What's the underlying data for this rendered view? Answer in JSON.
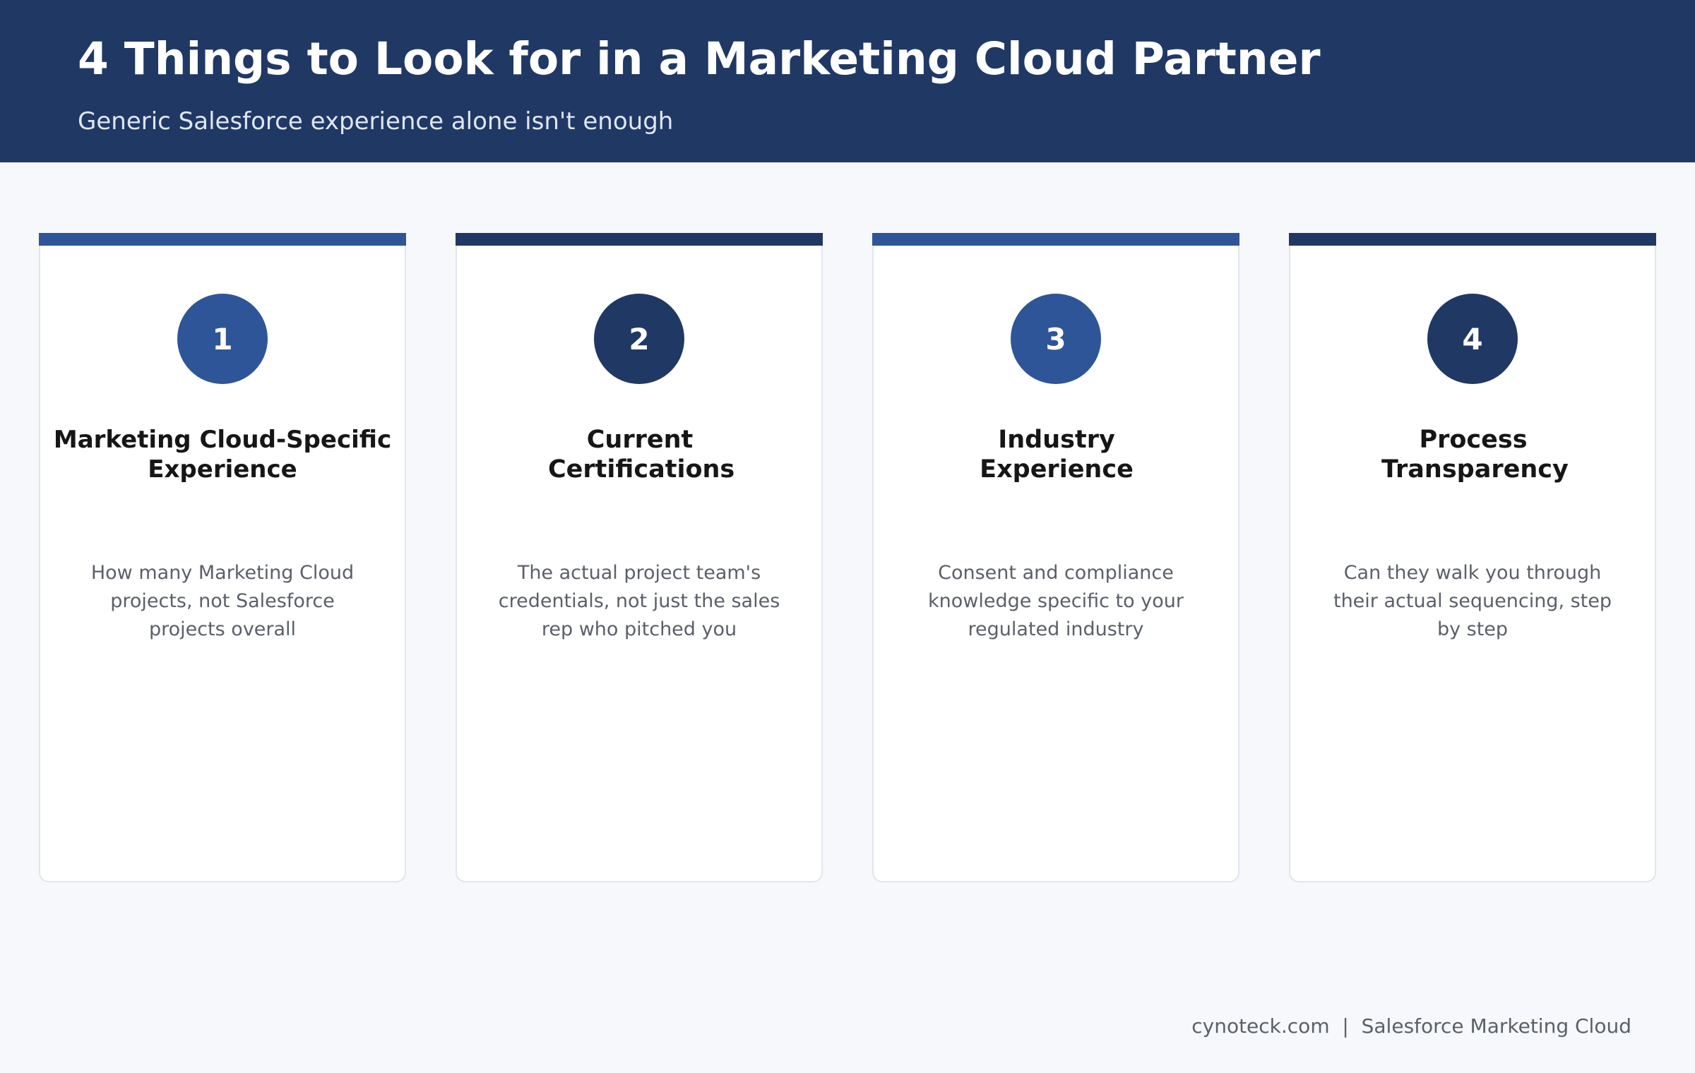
{
  "header": {
    "title": "4 Things to Look for in a Marketing Cloud Partner",
    "subtitle": "Generic Salesforce experience alone isn't enough"
  },
  "colors": {
    "header_bg": "#203864",
    "accent_light": "#2e5597",
    "accent_dark": "#203864",
    "page_bg": "#f7f8fb"
  },
  "cards": [
    {
      "number": "1",
      "title": "Marketing Cloud-Specific Experience",
      "description": "How many Marketing Cloud projects, not Salesforce projects overall",
      "color": "#2e5597"
    },
    {
      "number": "2",
      "title": "Current Certifications",
      "description": "The actual project team's credentials, not just the sales rep who pitched you",
      "color": "#203864"
    },
    {
      "number": "3",
      "title": "Industry Experience",
      "description": "Consent and compliance knowledge specific to your regulated industry",
      "color": "#2e5597"
    },
    {
      "number": "4",
      "title": "Process Transparency",
      "description": "Can they walk you through their actual sequencing, step by step",
      "color": "#203864"
    }
  ],
  "footer": {
    "text": "cynoteck.com  |  Salesforce Marketing Cloud"
  }
}
